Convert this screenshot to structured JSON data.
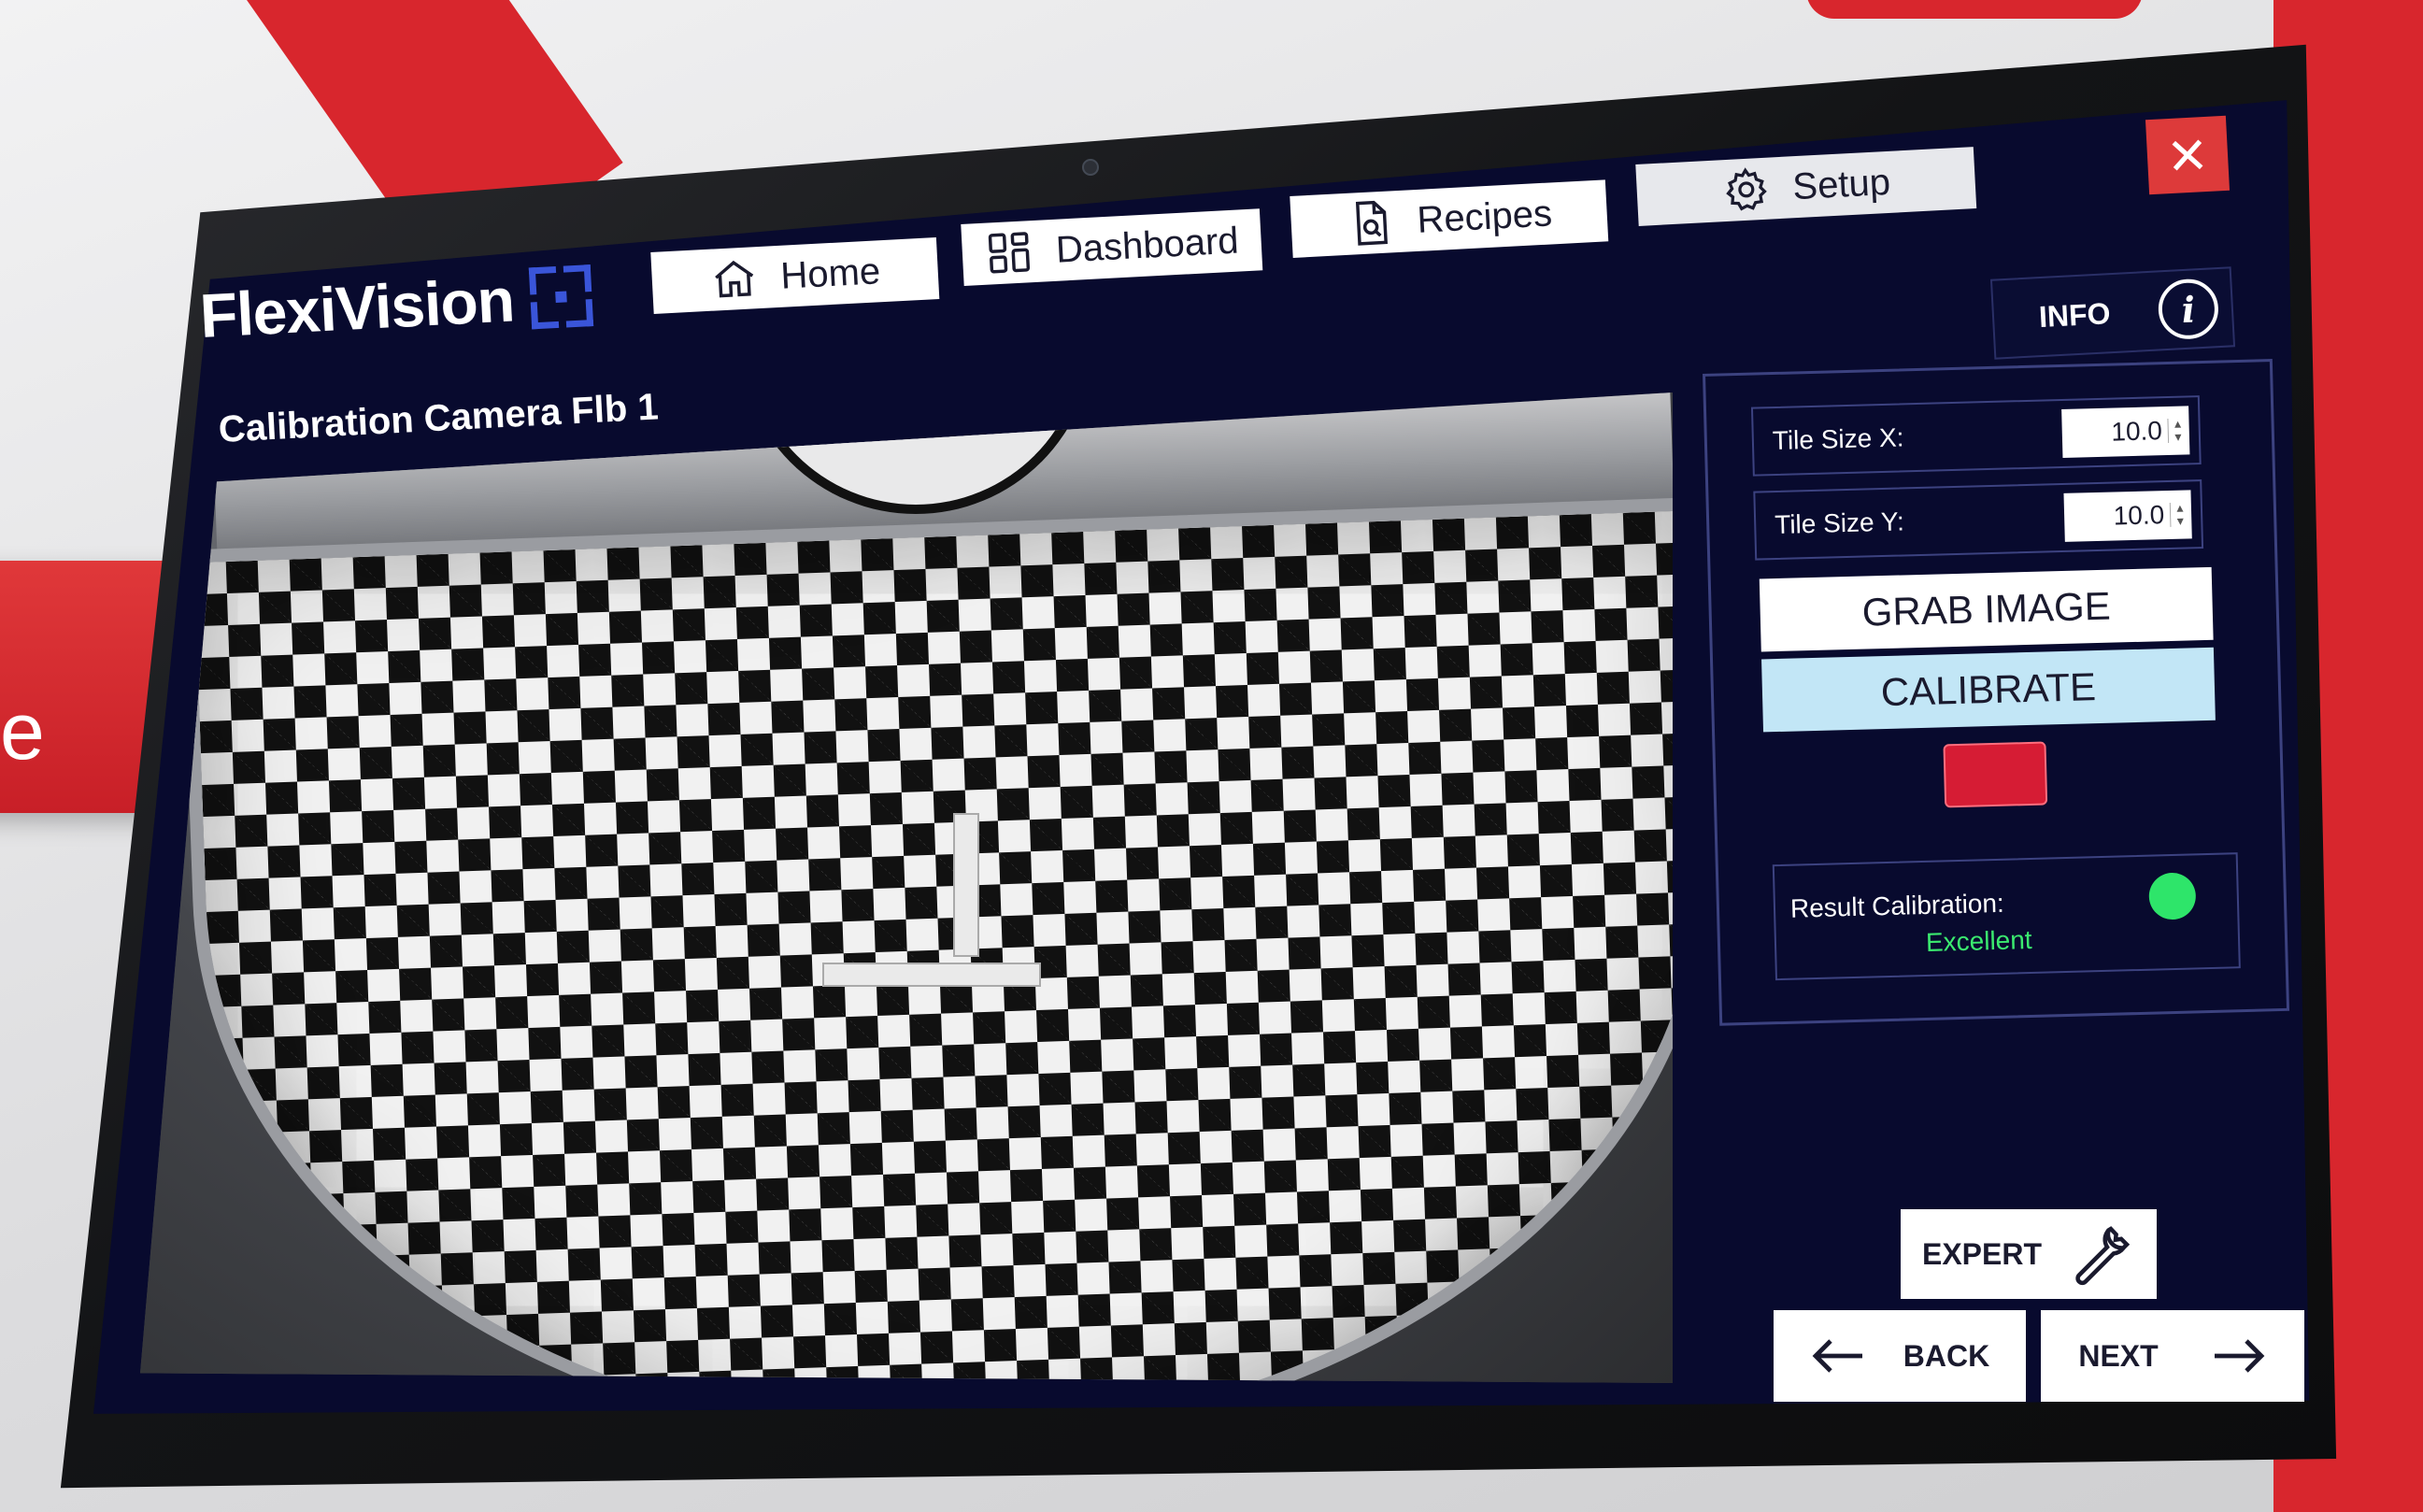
{
  "background": {
    "card_text": "e",
    "accent_color": "#d8262d"
  },
  "app": {
    "logo": "FlexiVision",
    "logo_icon": "scan-target-icon"
  },
  "nav": {
    "tabs": [
      {
        "label": "Home",
        "icon": "home-icon"
      },
      {
        "label": "Dashboard",
        "icon": "grid-icon"
      },
      {
        "label": "Recipes",
        "icon": "document-search-icon"
      },
      {
        "label": "Setup",
        "icon": "gear-icon"
      }
    ],
    "close_icon": "close-icon",
    "close_color": "#dd3a3a"
  },
  "info": {
    "label": "INFO",
    "icon_glyph": "i"
  },
  "page": {
    "title": "Calibration Camera Flb 1"
  },
  "calibration": {
    "tile_size_x_label": "Tile Size X:",
    "tile_size_x_value": "10.0",
    "tile_size_y_label": "Tile Size Y:",
    "tile_size_y_value": "10.0",
    "grab_image_label": "GRAB IMAGE",
    "calibrate_label": "CALIBRATE",
    "status_color": "#d61c34",
    "result_label": "Result Calibration:",
    "result_value": "Excellent",
    "result_color": "#2ee56a"
  },
  "footer": {
    "expert_label": "EXPERT",
    "expert_icon": "wrench-icon",
    "back_label": "BACK",
    "back_icon": "arrow-left-icon",
    "next_label": "NEXT",
    "next_icon": "arrow-right-icon"
  }
}
